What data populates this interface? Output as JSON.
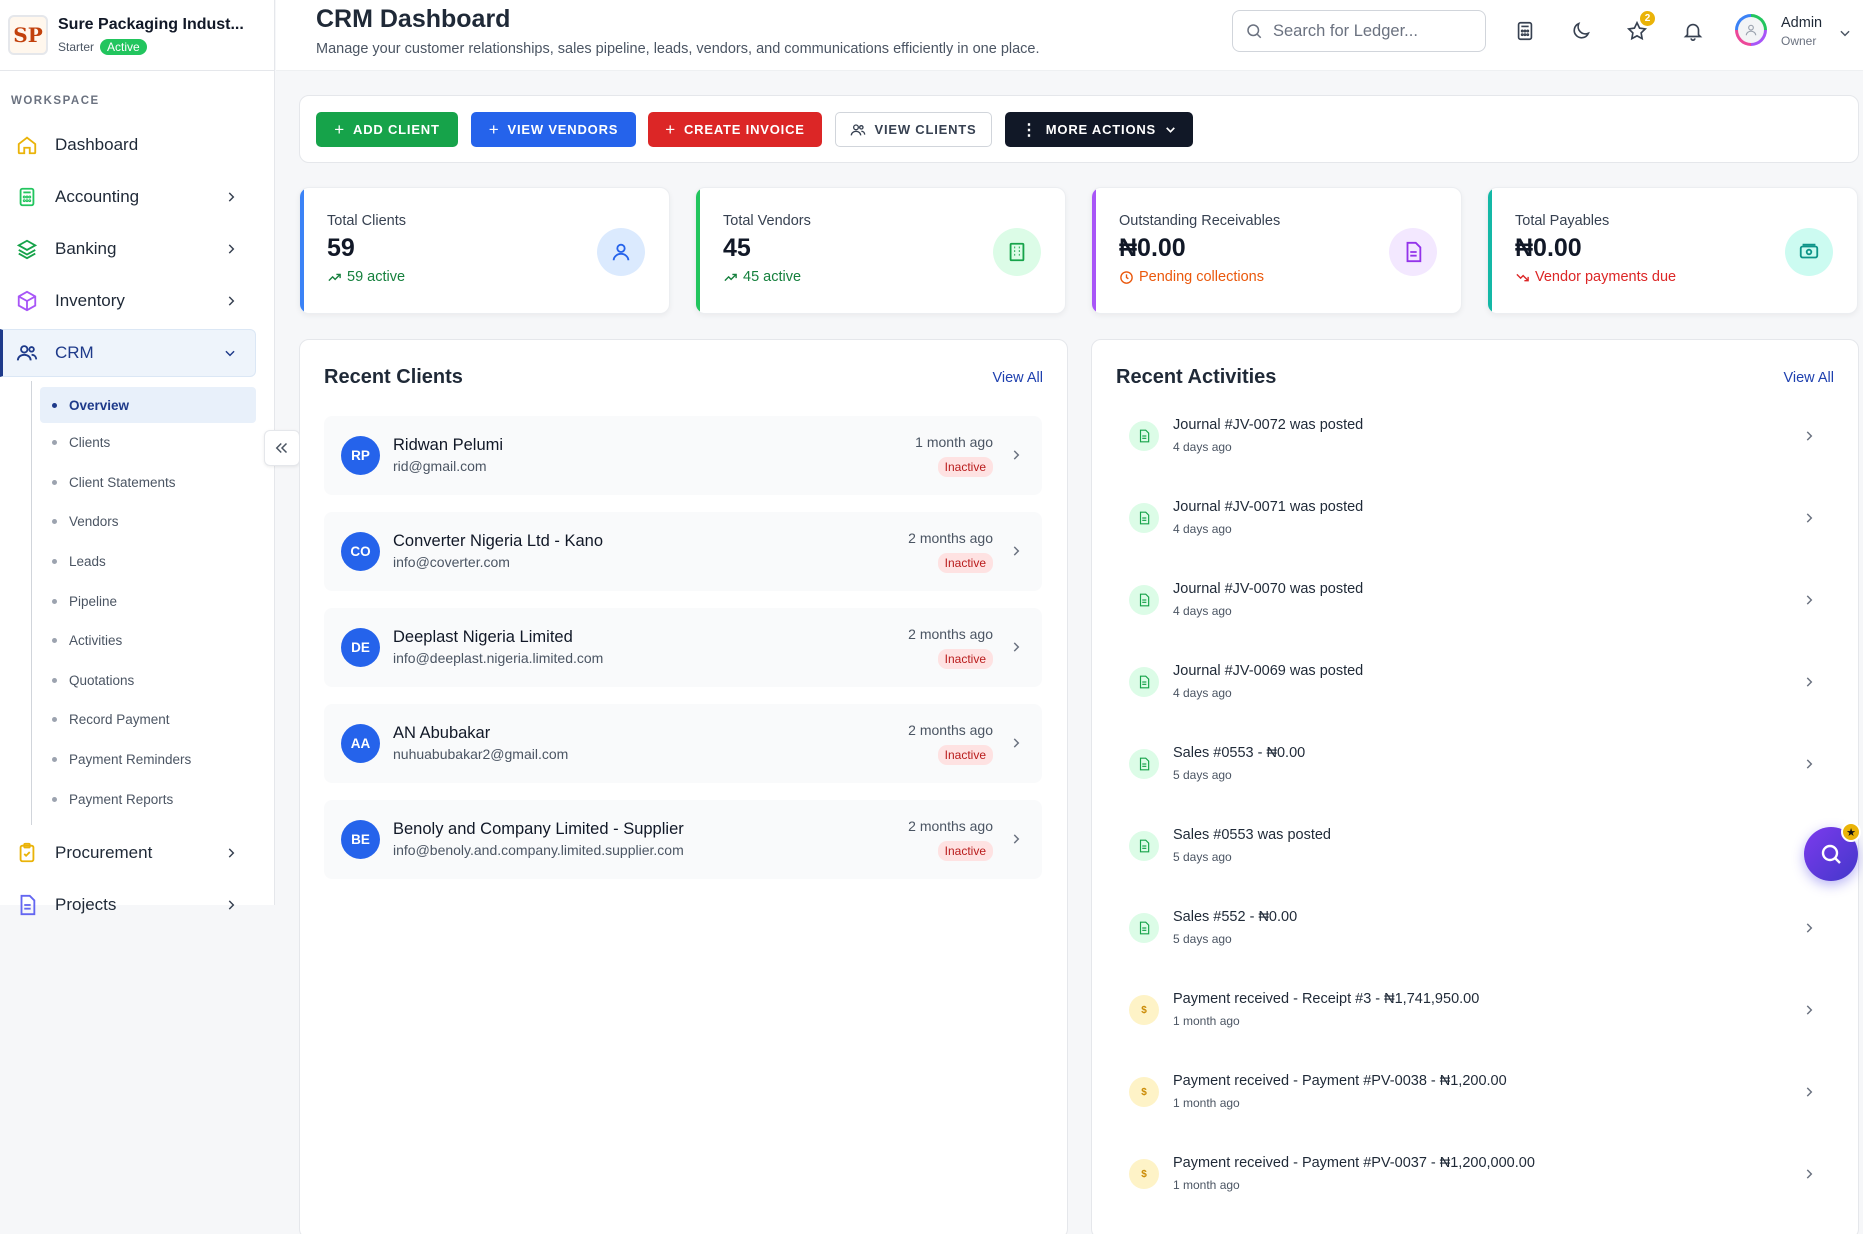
{
  "brand": {
    "name": "Sure Packaging Indust...",
    "logo_text": "SP",
    "plan": "Starter",
    "status": "Active"
  },
  "sidebar": {
    "section_label": "WORKSPACE",
    "items": [
      {
        "label": "Dashboard"
      },
      {
        "label": "Accounting"
      },
      {
        "label": "Banking"
      },
      {
        "label": "Inventory"
      },
      {
        "label": "CRM"
      },
      {
        "label": "Procurement"
      },
      {
        "label": "Projects"
      }
    ],
    "crm_sub": [
      {
        "label": "Overview"
      },
      {
        "label": "Clients"
      },
      {
        "label": "Client Statements"
      },
      {
        "label": "Vendors"
      },
      {
        "label": "Leads"
      },
      {
        "label": "Pipeline"
      },
      {
        "label": "Activities"
      },
      {
        "label": "Quotations"
      },
      {
        "label": "Record Payment"
      },
      {
        "label": "Payment Reminders"
      },
      {
        "label": "Payment Reports"
      }
    ]
  },
  "header": {
    "title": "CRM Dashboard",
    "subtitle": "Manage your customer relationships, sales pipeline, leads, vendors, and communications efficiently in one place.",
    "search_placeholder": "Search for Ledger...",
    "notif_count": "2",
    "user_name": "Admin",
    "user_role": "Owner"
  },
  "actions": {
    "add_client": "ADD CLIENT",
    "view_vendors": "VIEW VENDORS",
    "create_invoice": "CREATE INVOICE",
    "view_clients": "VIEW CLIENTS",
    "more_actions": "MORE ACTIONS"
  },
  "stats": [
    {
      "title": "Total Clients",
      "value": "59",
      "foot": "59 active",
      "color": "#3b82f6"
    },
    {
      "title": "Total Vendors",
      "value": "45",
      "foot": "45 active",
      "color": "#22c55e"
    },
    {
      "title": "Outstanding Receivables",
      "value": "₦0.00",
      "foot": "Pending collections",
      "color": "#a855f7"
    },
    {
      "title": "Total Payables",
      "value": "₦0.00",
      "foot": "Vendor payments due",
      "color": "#14b8a6"
    }
  ],
  "recent_clients": {
    "title": "Recent Clients",
    "view_all": "View All",
    "rows": [
      {
        "initials": "RP",
        "name": "Ridwan Pelumi",
        "email": "rid@gmail.com",
        "time": "1 month ago",
        "status": "Inactive"
      },
      {
        "initials": "CO",
        "name": "Converter Nigeria Ltd - Kano",
        "email": "info@coverter.com",
        "time": "2 months ago",
        "status": "Inactive"
      },
      {
        "initials": "DE",
        "name": "Deeplast Nigeria Limited",
        "email": "info@deeplast.nigeria.limited.com",
        "time": "2 months ago",
        "status": "Inactive"
      },
      {
        "initials": "AA",
        "name": "AN Abubakar",
        "email": "nuhuabubakar2@gmail.com",
        "time": "2 months ago",
        "status": "Inactive"
      },
      {
        "initials": "BE",
        "name": "Benoly and Company Limited - Supplier",
        "email": "info@benoly.and.company.limited.supplier.com",
        "time": "2 months ago",
        "status": "Inactive"
      }
    ]
  },
  "recent_activities": {
    "title": "Recent Activities",
    "view_all": "View All",
    "rows": [
      {
        "title": "Journal #JV-0072 was posted",
        "time": "4 days ago",
        "kind": "doc"
      },
      {
        "title": "Journal #JV-0071 was posted",
        "time": "4 days ago",
        "kind": "doc"
      },
      {
        "title": "Journal #JV-0070 was posted",
        "time": "4 days ago",
        "kind": "doc"
      },
      {
        "title": "Journal #JV-0069 was posted",
        "time": "4 days ago",
        "kind": "doc"
      },
      {
        "title": "Sales #0553 - ₦0.00",
        "time": "5 days ago",
        "kind": "doc"
      },
      {
        "title": "Sales #0553 was posted",
        "time": "5 days ago",
        "kind": "doc"
      },
      {
        "title": "Sales #552 - ₦0.00",
        "time": "5 days ago",
        "kind": "doc"
      },
      {
        "title": "Payment received - Receipt #3 - ₦1,741,950.00",
        "time": "1 month ago",
        "kind": "pay"
      },
      {
        "title": "Payment received - Payment #PV-0038 - ₦1,200.00",
        "time": "1 month ago",
        "kind": "pay"
      },
      {
        "title": "Payment received - Payment #PV-0037 - ₦1,200,000.00",
        "time": "1 month ago",
        "kind": "pay"
      }
    ]
  },
  "icons": {
    "payment_glyph": "$",
    "fab_badge": "★"
  }
}
